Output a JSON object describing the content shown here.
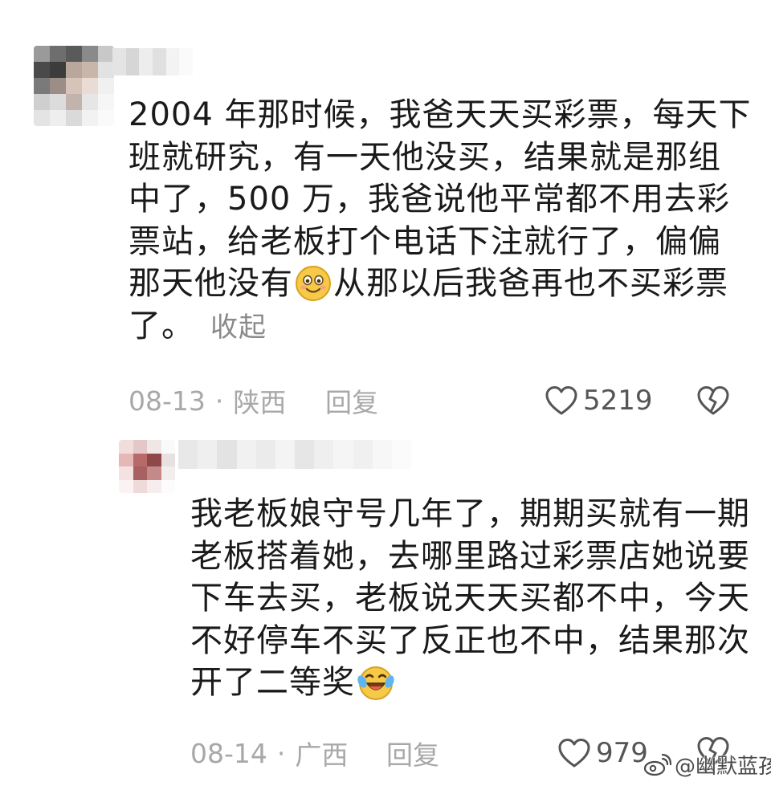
{
  "comments": [
    {
      "lines": [
        "2004 年那时候，我爸天天买彩票，每天下",
        "班就研究，有一天他没买，结果就是那组",
        "中了，500 万，我爸说他平常都不用去彩",
        "票站，给老板打个电话下注就行了，偏偏"
      ],
      "line5_before": "那天他没有",
      "line5_after": "从那以后我爸再也不买彩票",
      "line6": "了。",
      "collapse": "收起",
      "emoji": "smiling-face-icon",
      "date": "08-13",
      "separator": "·",
      "location": "陕西",
      "reply": "回复",
      "likes": "5219"
    },
    {
      "lines": [
        "我老板娘守号几年了，期期买就有一期",
        "老板搭着她，去哪里路过彩票店她说要",
        "下车去买，老板说天天买都不中，今天",
        "不好停车不买了反正也不中，结果那次"
      ],
      "line5_before": "开了二等奖",
      "emoji": "crying-laughing-face-icon",
      "date": "08-14",
      "separator": "·",
      "location": "广西",
      "reply": "回复",
      "likes": "979"
    }
  ],
  "watermark": {
    "text": "@幽默蓝孩",
    "icon": "weibo-logo-icon"
  },
  "colors": {
    "text": "#1a1a1a",
    "meta": "#a8a8a8",
    "reply": "#555555",
    "collapse": "#8a8a8a"
  }
}
